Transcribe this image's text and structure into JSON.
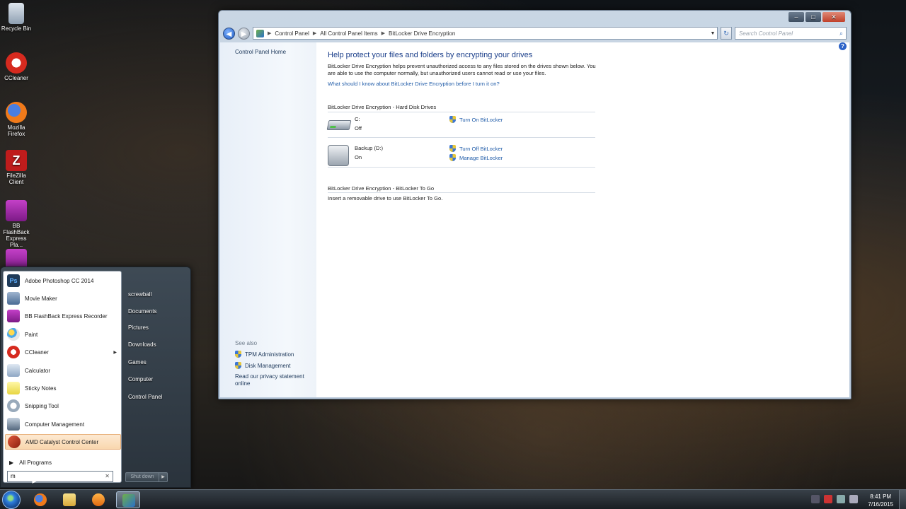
{
  "desktop": {
    "icons": [
      {
        "label": "Recycle Bin",
        "icon": "recycle-bin-icon"
      },
      {
        "label": "CCleaner",
        "icon": "ccleaner-icon"
      },
      {
        "label": "Mozilla Firefox",
        "icon": "firefox-icon"
      },
      {
        "label": "FileZilla Client",
        "icon": "filezilla-icon"
      },
      {
        "label": "BB FlashBack Express Pla...",
        "icon": "bb-flashback-player-icon"
      }
    ]
  },
  "window": {
    "controls": {
      "minimize": "–",
      "maximize": "□",
      "close": "✕"
    },
    "breadcrumbs": [
      "Control Panel",
      "All Control Panel Items",
      "BitLocker Drive Encryption"
    ],
    "search_placeholder": "Search Control Panel",
    "left_pane": {
      "home_link": "Control Panel Home",
      "see_also_label": "See also",
      "see_also_links": [
        "TPM Administration",
        "Disk Management"
      ],
      "privacy_link": "Read our privacy statement online"
    },
    "main": {
      "heading": "Help protect your files and folders by encrypting your drives",
      "description": "BitLocker Drive Encryption helps prevent unauthorized access to any files stored on the drives shown below. You are able to use the computer normally, but unauthorized users cannot read or use your files.",
      "question_link": "What should I know about BitLocker Drive Encryption before I turn it on?",
      "hard_disk_section": "BitLocker Drive Encryption - Hard Disk Drives",
      "drives": [
        {
          "name": "C:",
          "state": "Off",
          "actions": [
            "Turn On BitLocker"
          ]
        },
        {
          "name": "Backup (D:)",
          "state": "On",
          "actions": [
            "Turn Off BitLocker",
            "Manage BitLocker"
          ]
        }
      ],
      "to_go_section": "BitLocker Drive Encryption - BitLocker To Go",
      "to_go_text": "Insert a removable drive to use BitLocker To Go."
    }
  },
  "start_menu": {
    "programs": [
      "Adobe Photoshop CC 2014",
      "Movie Maker",
      "BB FlashBack Express Recorder",
      "Paint",
      "CCleaner",
      "Calculator",
      "Sticky Notes",
      "Snipping Tool",
      "Computer Management",
      "AMD Catalyst Control Center"
    ],
    "all_programs": "All Programs",
    "search_value": "m",
    "right_items": [
      "screwball",
      "Documents",
      "Pictures",
      "Downloads",
      "Games",
      "Computer",
      "Control Panel"
    ],
    "shutdown_label": "Shut down"
  },
  "taskbar": {
    "time": "8:41 PM",
    "date": "7/16/2015"
  }
}
